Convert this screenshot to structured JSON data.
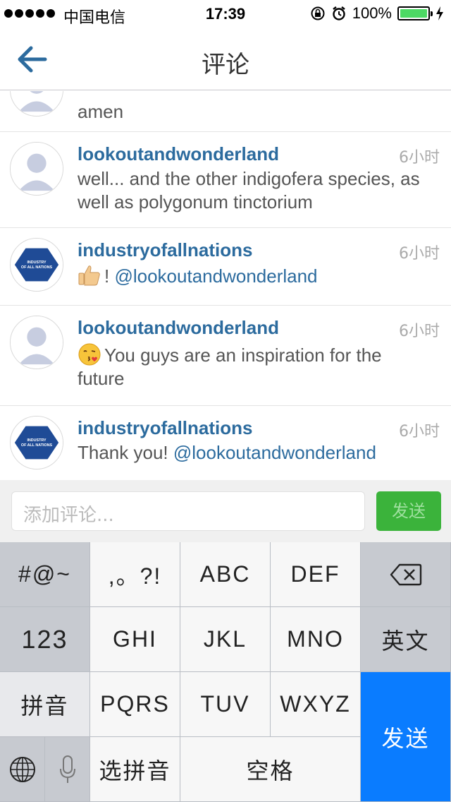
{
  "status_bar": {
    "carrier": "中国电信",
    "time": "17:39",
    "battery": "100%",
    "battery_level": 1.0
  },
  "nav": {
    "title": "评论",
    "back_icon": "back-arrow-icon"
  },
  "comments": [
    {
      "user": "",
      "time": "",
      "text": "amen",
      "avatar": "default"
    },
    {
      "user": "lookoutandwonderland",
      "time": "6小时",
      "text": "well... and the other indigofera species, as well as polygonum tinctorium",
      "avatar": "default"
    },
    {
      "user": "industryofallnations",
      "time": "6小时",
      "text_pre": "!",
      "mention": "@lookoutandwonderland",
      "emoji": "thumbs-up",
      "avatar": "brand"
    },
    {
      "user": "lookoutandwonderland",
      "time": "6小时",
      "text": "You guys are an inspiration for the future",
      "emoji": "kiss-face",
      "avatar": "default"
    },
    {
      "user": "industryofallnations",
      "time": "6小时",
      "text_pre": "Thank you!",
      "mention": "@lookoutandwonderland",
      "avatar": "brand"
    }
  ],
  "brand_logo_text": "INDUSTRY OF ALL NATIONS",
  "input": {
    "placeholder": "添加评论...",
    "send_label": "发送"
  },
  "keyboard": {
    "row1": [
      "#@~",
      ",。?!",
      "ABC",
      "DEF",
      "delete"
    ],
    "row2": [
      "123",
      "GHI",
      "JKL",
      "MNO",
      "英文"
    ],
    "row3": [
      "拼音",
      "PQRS",
      "TUV",
      "WXYZ"
    ],
    "row4": [
      "globe",
      "mic",
      "选拼音",
      "空格"
    ],
    "return_label": "发送"
  },
  "colors": {
    "link": "#2c6b9e",
    "send_button": "#3bb33b",
    "return_key": "#0a7cff",
    "battery": "#4cd964"
  }
}
